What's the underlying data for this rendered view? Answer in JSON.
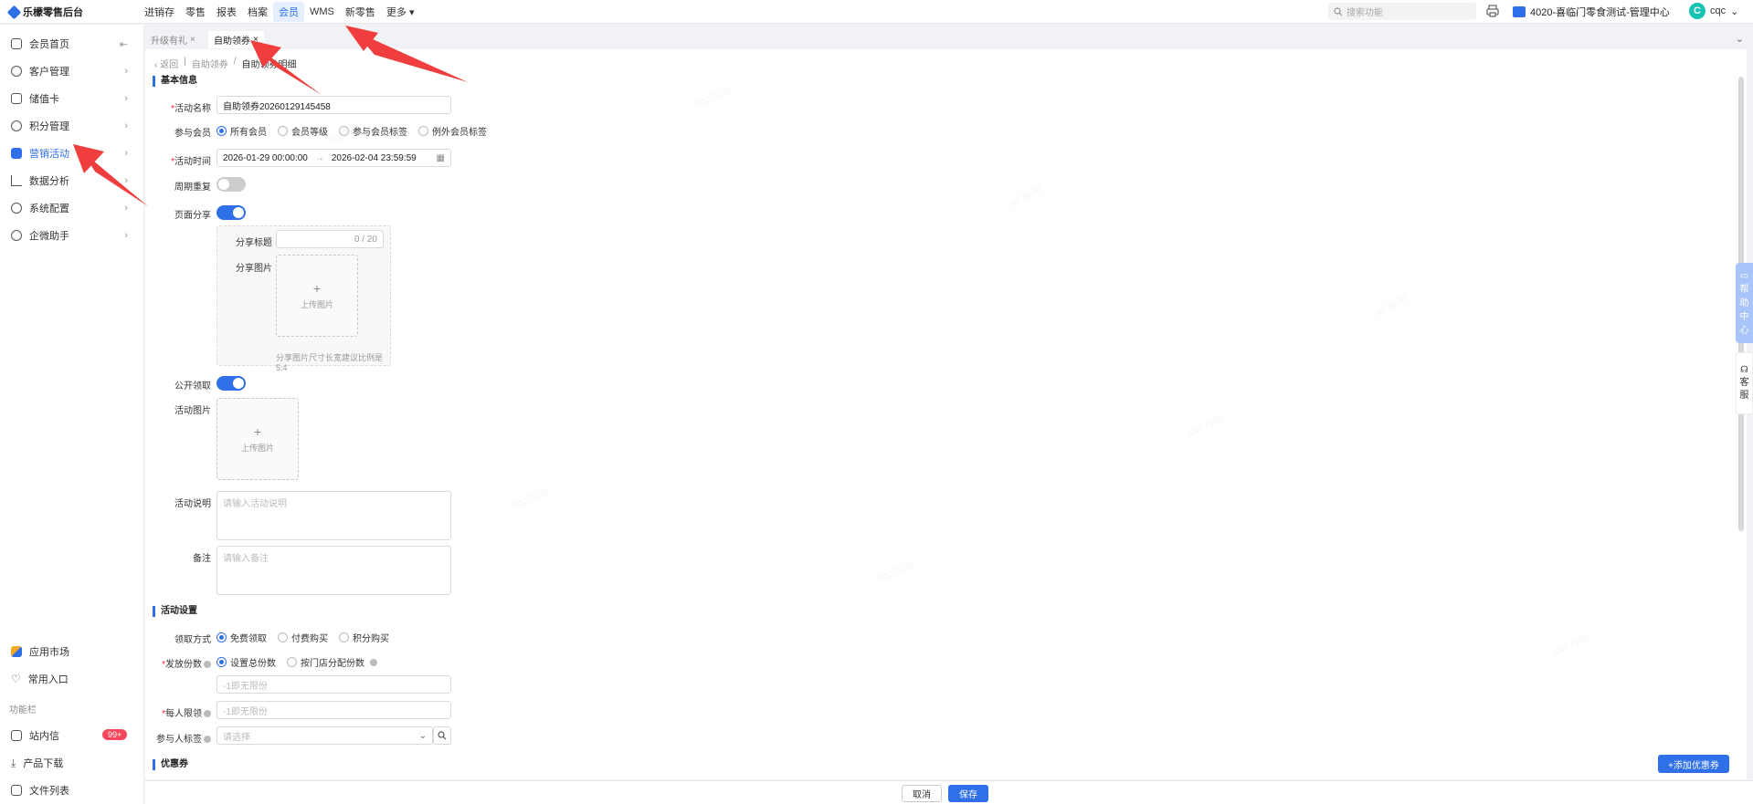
{
  "app": {
    "title": "乐檬零售后台"
  },
  "topnav": [
    "进销存",
    "零售",
    "报表",
    "档案",
    "会员",
    "WMS",
    "新零售",
    "更多"
  ],
  "topnav_active": 4,
  "search": {
    "placeholder": "搜索功能"
  },
  "store": {
    "name": "4020-喜临门零食测试-管理中心"
  },
  "user": {
    "avatar": "C",
    "name": "cqc"
  },
  "sidebar": {
    "items": [
      {
        "label": "会员首页"
      },
      {
        "label": "客户管理"
      },
      {
        "label": "储值卡"
      },
      {
        "label": "积分管理"
      },
      {
        "label": "营销活动"
      },
      {
        "label": "数据分析"
      },
      {
        "label": "系统配置"
      },
      {
        "label": "企微助手"
      }
    ],
    "bottom_items": [
      {
        "label": "应用市场"
      },
      {
        "label": "常用入口"
      }
    ],
    "section_label": "功能栏",
    "tool_items": [
      {
        "label": "站内信",
        "badge": "99+"
      },
      {
        "label": "产品下载"
      },
      {
        "label": "文件列表"
      }
    ]
  },
  "tabs": [
    {
      "label": "升级有礼"
    },
    {
      "label": "自助领券"
    }
  ],
  "breadcrumb": {
    "back": "返回",
    "parent": "自助领券",
    "current": "自助领券明细"
  },
  "basic": {
    "title": "基本信息",
    "name_label": "活动名称",
    "name_value": "自助领券20260129145458",
    "members_label": "参与会员",
    "members_options": [
      "所有会员",
      "会员等级",
      "参与会员标签",
      "例外会员标签"
    ],
    "time_label": "活动时间",
    "time_start": "2026-01-29 00:00:00",
    "time_sep": "→",
    "time_end": "2026-02-04 23:59:59",
    "repeat_label": "周期重复",
    "share_label": "页面分享",
    "share_title_label": "分享标题",
    "share_title_count": "0 / 20",
    "share_image_label": "分享图片",
    "upload_label": "上传图片",
    "share_hint": "分享图片尺寸长宽建议比例是5:4",
    "public_label": "公开领取",
    "activity_image_label": "活动图片",
    "desc_label": "活动说明",
    "desc_placeholder": "请输入活动说明",
    "remark_label": "备注",
    "remark_placeholder": "请输入备注"
  },
  "settings": {
    "title": "活动设置",
    "method_label": "领取方式",
    "method_options": [
      "免费领取",
      "付费购买",
      "积分购买"
    ],
    "quantity_label": "发放份数",
    "quantity_options": [
      "设置总份数",
      "按门店分配份数"
    ],
    "quantity_placeholder": "-1即无限份",
    "limit_label": "每人限领",
    "limit_placeholder": "-1即无限份",
    "tag_label": "参与人标签",
    "tag_placeholder": "请选择"
  },
  "coupons": {
    "title": "优惠券",
    "add_label": "+添加优惠券"
  },
  "footer": {
    "cancel": "取消",
    "save": "保存"
  },
  "floats": {
    "help": [
      "帮",
      "助",
      "中",
      "心"
    ],
    "service": [
      "客",
      "服"
    ]
  },
  "watermark": "cqc7636",
  "colors": {
    "accent": "#2f6fe8",
    "required": "#f5222d",
    "badge": "#f5475b",
    "arrow": "#f03e3e"
  }
}
